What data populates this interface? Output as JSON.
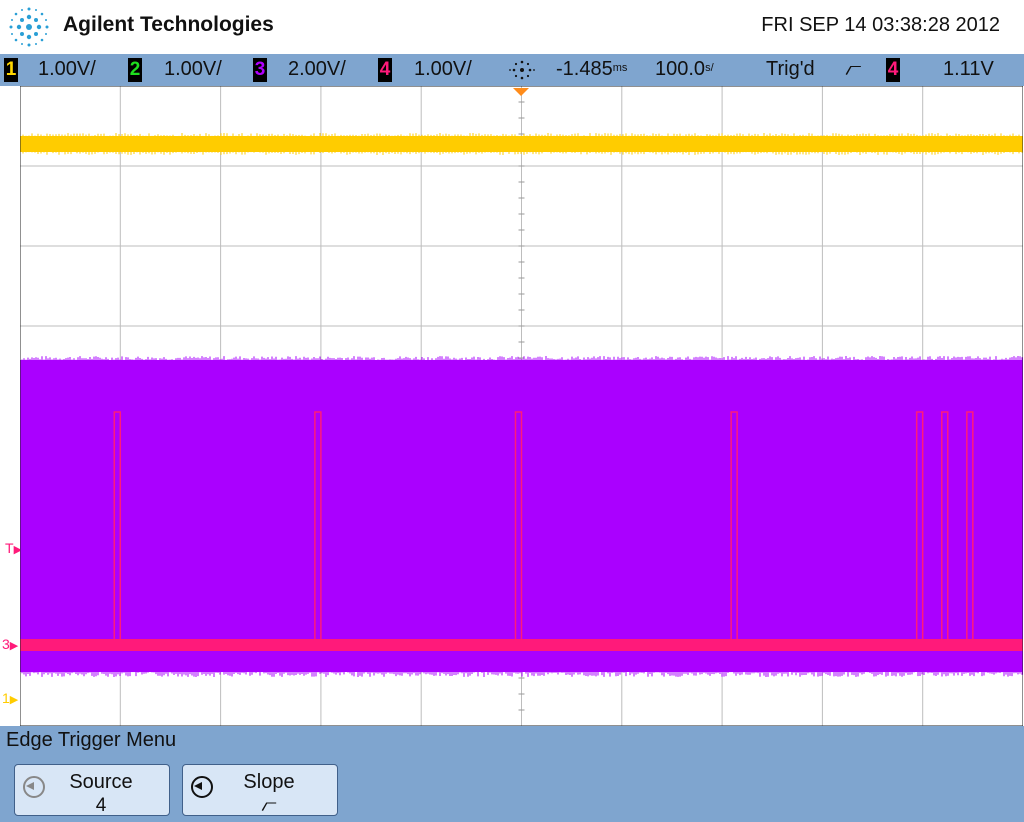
{
  "header": {
    "brand": "Agilent Technologies",
    "datetime": "FRI SEP 14 03:38:28 2012"
  },
  "status": {
    "ch1": {
      "num": "1",
      "scale": "1.00V/",
      "color": "#ffd700"
    },
    "ch2": {
      "num": "2",
      "scale": "1.00V/",
      "color": "#1fe01f"
    },
    "ch3": {
      "num": "3",
      "scale": "2.00V/",
      "color": "#b000ff"
    },
    "ch4": {
      "num": "4",
      "scale": "1.00V/",
      "color": "#ff1a7a"
    },
    "delay": "-1.485",
    "delay_unit": "ms",
    "timebase": "100.0",
    "timebase_unit": "s/",
    "trig_status": "Trig'd",
    "trig_slope": "⦧",
    "trig_source": "4",
    "trig_level": "1.11V"
  },
  "markers": {
    "trigger": "T",
    "ch3": "3",
    "ch1": "1"
  },
  "menu": {
    "title": "Edge Trigger Menu",
    "softkeys": [
      {
        "label": "Source",
        "value": "4"
      },
      {
        "label": "Slope",
        "value": "⦧"
      }
    ]
  },
  "colors": {
    "ch1": "#ffcc00",
    "ch3": "#aa00ff",
    "ch4": "#ff1a7a",
    "grid": "#bdbdbd",
    "panel": "#7fa5cf"
  },
  "trace": {
    "ch4_pulse_divs": [
      0.97,
      2.97,
      4.97,
      7.12,
      8.97,
      9.22,
      9.47
    ]
  }
}
